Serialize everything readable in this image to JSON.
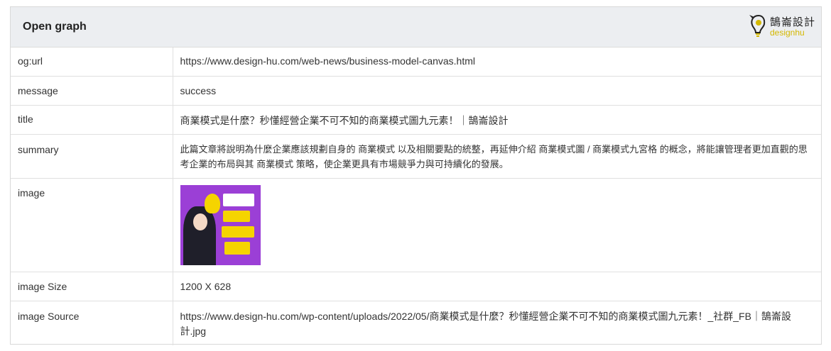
{
  "header": {
    "title": "Open graph",
    "logo": {
      "cn": "鵠崙設計",
      "en": "designhu"
    }
  },
  "rows": [
    {
      "key": "og:url",
      "value": "https://www.design-hu.com/web-news/business-model-canvas.html"
    },
    {
      "key": "message",
      "value": "success"
    },
    {
      "key": "title",
      "value": "商業模式是什麼？秒懂經營企業不可不知的商業模式圖九元素！｜鵠崙設計"
    },
    {
      "key": "summary",
      "value": "此篇文章將說明為什麼企業應該規劃自身的 商業模式 以及相關要點的統整，再延伸介紹 商業模式圖 / 商業模式九宮格 的概念，將能讓管理者更加直觀的思考企業的布局與其 商業模式 策略，使企業更具有市場競爭力與可持續化的發展。"
    },
    {
      "key": "image",
      "value": ""
    },
    {
      "key": "image Size",
      "value": "1200 X 628"
    },
    {
      "key": "image Source",
      "value": "https://www.design-hu.com/wp-content/uploads/2022/05/商業模式是什麼？秒懂經營企業不可不知的商業模式圖九元素！_社群_FB｜鵠崙設計.jpg"
    }
  ],
  "colors": {
    "header_bg": "#eceef1",
    "logo_accent": "#d4b800",
    "thumb_bg": "#9b3fd6"
  }
}
